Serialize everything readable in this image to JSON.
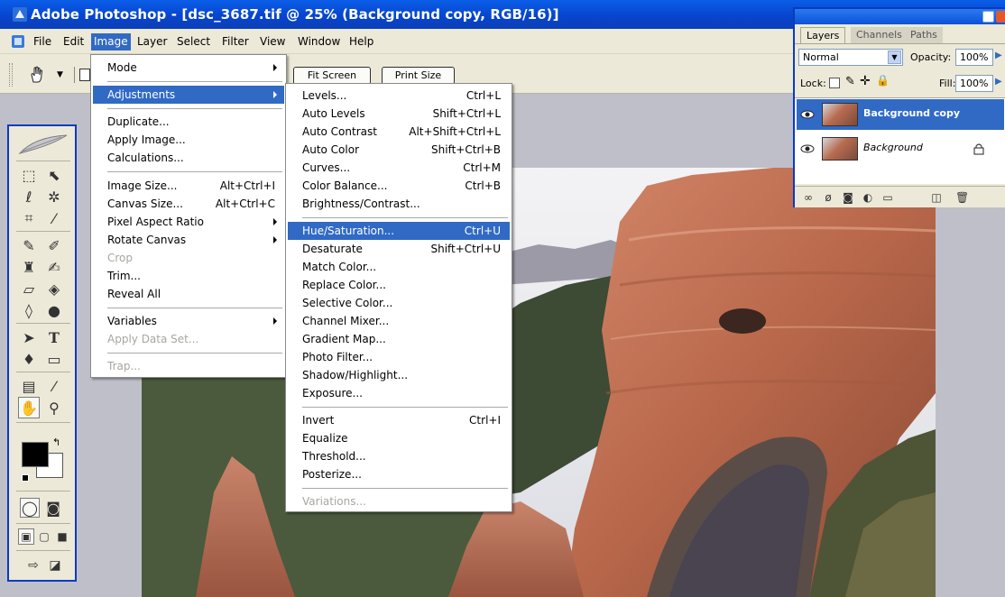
{
  "window": {
    "title": "Adobe Photoshop - [dsc_3687.tif @ 25% (Background copy, RGB/16)]"
  },
  "menubar": {
    "items": [
      "File",
      "Edit",
      "Image",
      "Layer",
      "Select",
      "Filter",
      "View",
      "Window",
      "Help"
    ],
    "active": "Image"
  },
  "options": {
    "fit_screen": "Fit Screen",
    "print_size": "Print Size"
  },
  "image_menu": {
    "items": [
      {
        "label": "Mode",
        "submenu": true
      },
      {
        "label": "Adjustments",
        "submenu": true,
        "highlighted": true
      },
      {
        "label": "Duplicate..."
      },
      {
        "label": "Apply Image..."
      },
      {
        "label": "Calculations..."
      },
      {
        "label": "Image Size...",
        "shortcut": "Alt+Ctrl+I"
      },
      {
        "label": "Canvas Size...",
        "shortcut": "Alt+Ctrl+C"
      },
      {
        "label": "Pixel Aspect Ratio",
        "submenu": true
      },
      {
        "label": "Rotate Canvas",
        "submenu": true
      },
      {
        "label": "Crop",
        "disabled": true
      },
      {
        "label": "Trim..."
      },
      {
        "label": "Reveal All"
      },
      {
        "label": "Variables",
        "submenu": true
      },
      {
        "label": "Apply Data Set...",
        "disabled": true
      },
      {
        "label": "Trap...",
        "disabled": true
      }
    ]
  },
  "adjustments_menu": {
    "items": [
      {
        "label": "Levels...",
        "shortcut": "Ctrl+L"
      },
      {
        "label": "Auto Levels",
        "shortcut": "Shift+Ctrl+L"
      },
      {
        "label": "Auto Contrast",
        "shortcut": "Alt+Shift+Ctrl+L"
      },
      {
        "label": "Auto Color",
        "shortcut": "Shift+Ctrl+B"
      },
      {
        "label": "Curves...",
        "shortcut": "Ctrl+M"
      },
      {
        "label": "Color Balance...",
        "shortcut": "Ctrl+B"
      },
      {
        "label": "Brightness/Contrast..."
      },
      {
        "label": "Hue/Saturation...",
        "shortcut": "Ctrl+U",
        "highlighted": true
      },
      {
        "label": "Desaturate",
        "shortcut": "Shift+Ctrl+U"
      },
      {
        "label": "Match Color..."
      },
      {
        "label": "Replace Color..."
      },
      {
        "label": "Selective Color..."
      },
      {
        "label": "Channel Mixer..."
      },
      {
        "label": "Gradient Map..."
      },
      {
        "label": "Photo Filter..."
      },
      {
        "label": "Shadow/Highlight..."
      },
      {
        "label": "Exposure..."
      },
      {
        "label": "Invert",
        "shortcut": "Ctrl+I"
      },
      {
        "label": "Equalize"
      },
      {
        "label": "Threshold..."
      },
      {
        "label": "Posterize..."
      },
      {
        "label": "Variations...",
        "disabled": true
      }
    ]
  },
  "layers_panel": {
    "tabs": [
      "Layers",
      "Channels",
      "Paths"
    ],
    "active_tab": "Layers",
    "blend_mode": "Normal",
    "opacity_label": "Opacity:",
    "opacity": "100%",
    "lock_label": "Lock:",
    "fill_label": "Fill:",
    "fill": "100%",
    "layers": [
      {
        "name": "Background copy",
        "selected": true,
        "locked": false
      },
      {
        "name": "Background",
        "selected": false,
        "locked": true
      }
    ]
  },
  "colors": {
    "accent": "#316ac5",
    "titlebar": "#0745cf",
    "chrome": "#ece9d8",
    "canvas": "#bfbfc9"
  },
  "icons": [
    "photoshop-app-icon",
    "hand-tool-icon",
    "feather-logo-icon",
    "eye-icon",
    "lock-icon",
    "trash-icon"
  ]
}
